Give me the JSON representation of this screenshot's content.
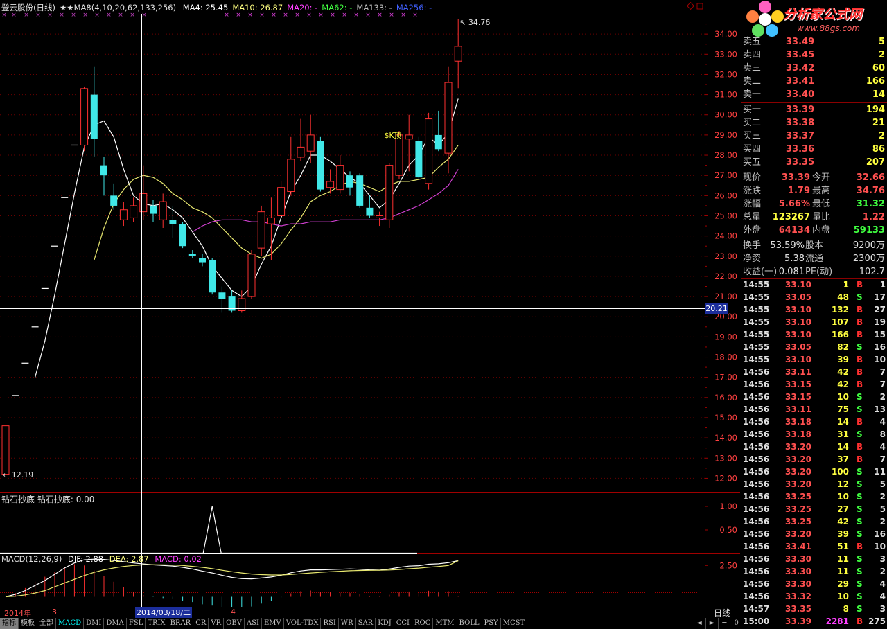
{
  "header": {
    "title": "登云股份(日线)",
    "stars": "★★",
    "ma_params": "MA8(4,10,20,62,133,256)",
    "ma_items": [
      {
        "label": "MA4: 25.45",
        "color": "#ffffff"
      },
      {
        "label": "MA10: 26.87",
        "color": "#ffff80"
      },
      {
        "label": "MA20: -",
        "color": "#ff40ff"
      },
      {
        "label": "MA62: -",
        "color": "#40ff40"
      },
      {
        "label": "MA133: -",
        "color": "#c0c0c0"
      },
      {
        "label": "MA256: -",
        "color": "#4060ff"
      }
    ]
  },
  "price_axis": {
    "ticks": [
      "34.00",
      "33.00",
      "32.00",
      "31.00",
      "30.00",
      "29.00",
      "28.00",
      "27.00",
      "26.00",
      "25.00",
      "24.00",
      "23.00",
      "22.00",
      "21.00",
      "20.00",
      "19.00",
      "18.00",
      "17.00",
      "16.00",
      "15.00",
      "14.00",
      "13.00",
      "12.00"
    ],
    "cursor_value": "20.21"
  },
  "annotations": {
    "high": "34.76",
    "low": "12.19",
    "marker": "$K顶"
  },
  "indicator": {
    "title": "钻石抄底",
    "value_label": "钻石抄底: 0.00",
    "ticks": [
      "1.00",
      "0.50"
    ]
  },
  "macd": {
    "params": "MACD(12,26,9)",
    "dif": "DIF: 2.88",
    "dea": "DEA: 2.87",
    "macd": "MACD: 0.02",
    "tick": "2.50"
  },
  "dates": {
    "year": "2014年",
    "m3": "3",
    "cursor": "2014/03/18/二",
    "m4": "4",
    "period": "日线"
  },
  "tabs": [
    "指标",
    "模板",
    "全部",
    "MACD",
    "DMI",
    "DMA",
    "FSL",
    "TRIX",
    "BRAR",
    "CR",
    "VR",
    "OBV",
    "ASI",
    "EMV",
    "VOL-TDX",
    "RSI",
    "WR",
    "SAR",
    "KDJ",
    "CCI",
    "ROC",
    "MTM",
    "BOLL",
    "PSY",
    "MCST"
  ],
  "nav_buttons": [
    "◄",
    "►",
    "─",
    "0"
  ],
  "logo": {
    "text": "分析家公式网",
    "url": "www.88gs.com"
  },
  "order_book": {
    "sell": [
      {
        "label": "卖五",
        "price": "33.49",
        "vol": "5"
      },
      {
        "label": "卖四",
        "price": "33.45",
        "vol": "2"
      },
      {
        "label": "卖三",
        "price": "33.42",
        "vol": "60"
      },
      {
        "label": "卖二",
        "price": "33.41",
        "vol": "166"
      },
      {
        "label": "卖一",
        "price": "33.40",
        "vol": "14"
      }
    ],
    "buy": [
      {
        "label": "买一",
        "price": "33.39",
        "vol": "194"
      },
      {
        "label": "买二",
        "price": "33.38",
        "vol": "21"
      },
      {
        "label": "买三",
        "price": "33.37",
        "vol": "2"
      },
      {
        "label": "买四",
        "price": "33.36",
        "vol": "86"
      },
      {
        "label": "买五",
        "price": "33.35",
        "vol": "207"
      }
    ]
  },
  "quote": [
    {
      "l1": "现价",
      "v1": "33.39",
      "c1": "#ff5050",
      "l2": "今开",
      "v2": "32.66",
      "c2": "#ff5050"
    },
    {
      "l1": "涨跌",
      "v1": "1.79",
      "c1": "#ff5050",
      "l2": "最高",
      "v2": "34.76",
      "c2": "#ff5050"
    },
    {
      "l1": "涨幅",
      "v1": "5.66%",
      "c1": "#ff5050",
      "l2": "最低",
      "v2": "31.32",
      "c2": "#40ff40"
    },
    {
      "l1": "总量",
      "v1": "123267",
      "c1": "#ffff40",
      "l2": "量比",
      "v2": "1.22",
      "c2": "#ff5050"
    },
    {
      "l1": "外盘",
      "v1": "64134",
      "c1": "#ff5050",
      "l2": "内盘",
      "v2": "59133",
      "c2": "#40ff40"
    }
  ],
  "finance": [
    {
      "l1": "换手",
      "v1": "53.59%",
      "l2": "股本",
      "v2": "9200万"
    },
    {
      "l1": "净资",
      "v1": "5.38",
      "l2": "流通",
      "v2": "2300万"
    },
    {
      "l1": "收益(一)",
      "v1": "0.081",
      "l2": "PE(动)",
      "v2": "102.7"
    }
  ],
  "ticks": [
    [
      "14:55",
      "33.10",
      "1",
      "B",
      "1"
    ],
    [
      "14:55",
      "33.05",
      "48",
      "S",
      "17"
    ],
    [
      "14:55",
      "33.10",
      "132",
      "B",
      "27"
    ],
    [
      "14:55",
      "33.10",
      "107",
      "B",
      "19"
    ],
    [
      "14:55",
      "33.10",
      "166",
      "B",
      "15"
    ],
    [
      "14:55",
      "33.05",
      "82",
      "S",
      "16"
    ],
    [
      "14:55",
      "33.10",
      "39",
      "B",
      "10"
    ],
    [
      "14:56",
      "33.11",
      "42",
      "B",
      "7"
    ],
    [
      "14:56",
      "33.15",
      "42",
      "B",
      "7"
    ],
    [
      "14:56",
      "33.15",
      "10",
      "S",
      "2"
    ],
    [
      "14:56",
      "33.11",
      "75",
      "S",
      "13"
    ],
    [
      "14:56",
      "33.18",
      "14",
      "B",
      "4"
    ],
    [
      "14:56",
      "33.18",
      "31",
      "S",
      "8"
    ],
    [
      "14:56",
      "33.20",
      "14",
      "B",
      "4"
    ],
    [
      "14:56",
      "33.20",
      "37",
      "B",
      "7"
    ],
    [
      "14:56",
      "33.20",
      "100",
      "S",
      "11"
    ],
    [
      "14:56",
      "33.20",
      "12",
      "S",
      "5"
    ],
    [
      "14:56",
      "33.25",
      "10",
      "S",
      "2"
    ],
    [
      "14:56",
      "33.25",
      "27",
      "S",
      "5"
    ],
    [
      "14:56",
      "33.25",
      "42",
      "S",
      "2"
    ],
    [
      "14:56",
      "33.20",
      "39",
      "S",
      "16"
    ],
    [
      "14:56",
      "33.41",
      "51",
      "B",
      "10"
    ],
    [
      "14:56",
      "33.30",
      "11",
      "S",
      "3"
    ],
    [
      "14:56",
      "33.30",
      "11",
      "S",
      "2"
    ],
    [
      "14:56",
      "33.30",
      "29",
      "S",
      "4"
    ],
    [
      "14:56",
      "33.32",
      "10",
      "S",
      "4"
    ],
    [
      "14:57",
      "33.35",
      "8",
      "S",
      "3"
    ],
    [
      "15:00",
      "33.39",
      "2281",
      "B",
      "275"
    ]
  ],
  "chart_data": {
    "type": "candlestick",
    "ylim": [
      11.5,
      35.0
    ],
    "candles": [
      {
        "o": 12.2,
        "c": 14.6,
        "h": 14.6,
        "l": 12.19
      },
      {
        "o": 16.1,
        "c": 16.1,
        "h": 16.1,
        "l": 16.1
      },
      {
        "o": 17.7,
        "c": 17.7,
        "h": 17.7,
        "l": 17.7
      },
      {
        "o": 19.5,
        "c": 19.5,
        "h": 19.5,
        "l": 19.5
      },
      {
        "o": 21.4,
        "c": 21.4,
        "h": 21.4,
        "l": 21.4
      },
      {
        "o": 23.5,
        "c": 23.5,
        "h": 23.5,
        "l": 23.5
      },
      {
        "o": 25.9,
        "c": 25.9,
        "h": 25.9,
        "l": 25.9
      },
      {
        "o": 28.5,
        "c": 28.5,
        "h": 28.5,
        "l": 28.5
      },
      {
        "o": 28.5,
        "c": 31.3,
        "h": 31.4,
        "l": 28.2
      },
      {
        "o": 31.0,
        "c": 28.8,
        "h": 32.4,
        "l": 27.9
      },
      {
        "o": 27.5,
        "c": 27.0,
        "h": 27.9,
        "l": 26.0
      },
      {
        "o": 26.0,
        "c": 25.5,
        "h": 26.6,
        "l": 25.3
      },
      {
        "o": 24.8,
        "c": 25.3,
        "h": 25.7,
        "l": 24.5
      },
      {
        "o": 24.9,
        "c": 25.5,
        "h": 25.9,
        "l": 24.7
      },
      {
        "o": 25.2,
        "c": 26.1,
        "h": 27.5,
        "l": 24.8
      },
      {
        "o": 25.5,
        "c": 25.1,
        "h": 25.8,
        "l": 24.7
      },
      {
        "o": 24.8,
        "c": 25.7,
        "h": 26.1,
        "l": 24.4
      },
      {
        "o": 24.8,
        "c": 24.6,
        "h": 25.5,
        "l": 23.9
      },
      {
        "o": 24.6,
        "c": 23.5,
        "h": 24.7,
        "l": 23.4
      },
      {
        "o": 23.1,
        "c": 23.0,
        "h": 23.3,
        "l": 22.9
      },
      {
        "o": 22.9,
        "c": 22.7,
        "h": 23.1,
        "l": 22.5
      },
      {
        "o": 22.8,
        "c": 21.2,
        "h": 22.9,
        "l": 21.1
      },
      {
        "o": 21.2,
        "c": 20.9,
        "h": 21.5,
        "l": 20.2
      },
      {
        "o": 21.0,
        "c": 20.3,
        "h": 21.3,
        "l": 20.2
      },
      {
        "o": 20.3,
        "c": 20.9,
        "h": 21.3,
        "l": 20.2
      },
      {
        "o": 21.0,
        "c": 23.1,
        "h": 23.3,
        "l": 20.9
      },
      {
        "o": 23.4,
        "c": 25.2,
        "h": 25.5,
        "l": 23.0
      },
      {
        "o": 24.6,
        "c": 24.9,
        "h": 25.9,
        "l": 22.8
      },
      {
        "o": 25.0,
        "c": 26.4,
        "h": 26.7,
        "l": 24.9
      },
      {
        "o": 26.2,
        "c": 27.8,
        "h": 28.9,
        "l": 26.0
      },
      {
        "o": 27.9,
        "c": 28.4,
        "h": 29.8,
        "l": 27.7
      },
      {
        "o": 28.2,
        "c": 29.0,
        "h": 30.0,
        "l": 27.6
      },
      {
        "o": 28.7,
        "c": 26.3,
        "h": 28.9,
        "l": 26.2
      },
      {
        "o": 26.4,
        "c": 26.7,
        "h": 27.3,
        "l": 26.1
      },
      {
        "o": 26.3,
        "c": 27.5,
        "h": 28.0,
        "l": 26.1
      },
      {
        "o": 27.0,
        "c": 26.4,
        "h": 27.2,
        "l": 26.0
      },
      {
        "o": 27.0,
        "c": 25.5,
        "h": 27.1,
        "l": 25.4
      },
      {
        "o": 25.4,
        "c": 25.0,
        "h": 26.0,
        "l": 24.9
      },
      {
        "o": 24.9,
        "c": 25.0,
        "h": 25.2,
        "l": 24.5
      },
      {
        "o": 24.8,
        "c": 27.5,
        "h": 27.6,
        "l": 24.4
      },
      {
        "o": 27.0,
        "c": 29.0,
        "h": 29.2,
        "l": 26.8
      },
      {
        "o": 28.8,
        "c": 29.0,
        "h": 30.0,
        "l": 27.2
      },
      {
        "o": 28.7,
        "c": 26.9,
        "h": 28.9,
        "l": 26.8
      },
      {
        "o": 26.6,
        "c": 29.8,
        "h": 30.1,
        "l": 26.3
      },
      {
        "o": 29.0,
        "c": 28.3,
        "h": 30.2,
        "l": 28.2
      },
      {
        "o": 28.1,
        "c": 31.6,
        "h": 32.4,
        "l": 27.1
      },
      {
        "o": 32.66,
        "c": 33.39,
        "h": 34.76,
        "l": 31.32
      }
    ],
    "ma4": [
      null,
      null,
      null,
      17.0,
      18.8,
      21.1,
      23.6,
      26.1,
      28.4,
      29.5,
      29.7,
      28.9,
      27.3,
      26.0,
      25.6,
      25.5,
      25.6,
      25.3,
      24.9,
      24.2,
      23.5,
      22.5,
      21.9,
      21.3,
      21.0,
      21.5,
      22.6,
      23.5,
      24.9,
      26.2,
      27.0,
      28.0,
      28.0,
      27.7,
      27.3,
      26.9,
      26.6,
      26.0,
      25.4,
      25.8,
      26.6,
      27.5,
      28.0,
      28.9,
      28.5,
      29.1,
      30.8
    ],
    "ma10": [
      null,
      null,
      null,
      null,
      null,
      null,
      null,
      null,
      null,
      22.8,
      24.4,
      25.6,
      26.3,
      26.8,
      27.0,
      26.9,
      26.6,
      26.1,
      25.8,
      25.4,
      25.2,
      24.9,
      24.4,
      23.9,
      23.4,
      23.1,
      22.9,
      23.1,
      23.6,
      24.3,
      24.9,
      25.7,
      26.0,
      26.2,
      26.5,
      26.7,
      26.6,
      26.4,
      26.2,
      26.5,
      26.7,
      26.7,
      26.8,
      26.9,
      27.4,
      27.8,
      28.5
    ],
    "ma20": [
      null,
      null,
      null,
      null,
      null,
      null,
      null,
      null,
      null,
      null,
      null,
      null,
      null,
      null,
      null,
      null,
      null,
      null,
      null,
      24.2,
      24.5,
      24.7,
      24.8,
      24.8,
      24.8,
      24.7,
      24.7,
      24.6,
      24.5,
      24.6,
      24.6,
      24.7,
      24.7,
      24.7,
      24.8,
      24.8,
      24.8,
      24.8,
      24.8,
      24.9,
      25.1,
      25.3,
      25.5,
      25.8,
      26.1,
      26.5,
      27.3
    ],
    "indicator_signal_index": 21,
    "macd_dif": [
      0.0,
      0.2,
      0.5,
      0.9,
      1.3,
      1.8,
      2.3,
      2.7,
      2.95,
      3.0,
      2.98,
      2.9,
      2.8,
      2.7,
      2.62,
      2.55,
      2.5,
      2.45,
      2.35,
      2.22,
      2.05,
      1.9,
      1.72,
      1.55,
      1.45,
      1.43,
      1.5,
      1.58,
      1.72,
      1.92,
      2.06,
      2.15,
      2.15,
      2.18,
      2.2,
      2.23,
      2.2,
      2.15,
      2.13,
      2.22,
      2.35,
      2.45,
      2.48,
      2.6,
      2.63,
      2.72,
      2.88
    ],
    "macd_dea": [
      0.0,
      0.05,
      0.15,
      0.3,
      0.5,
      0.8,
      1.1,
      1.4,
      1.7,
      1.95,
      2.15,
      2.3,
      2.42,
      2.5,
      2.55,
      2.56,
      2.55,
      2.53,
      2.5,
      2.43,
      2.35,
      2.25,
      2.12,
      2.0,
      1.9,
      1.82,
      1.77,
      1.74,
      1.74,
      1.78,
      1.84,
      1.9,
      1.95,
      2.0,
      2.04,
      2.08,
      2.1,
      2.11,
      2.12,
      2.14,
      2.18,
      2.24,
      2.29,
      2.36,
      2.42,
      2.5,
      2.87
    ],
    "macd_ylim": [
      -0.8,
      3.4
    ]
  }
}
